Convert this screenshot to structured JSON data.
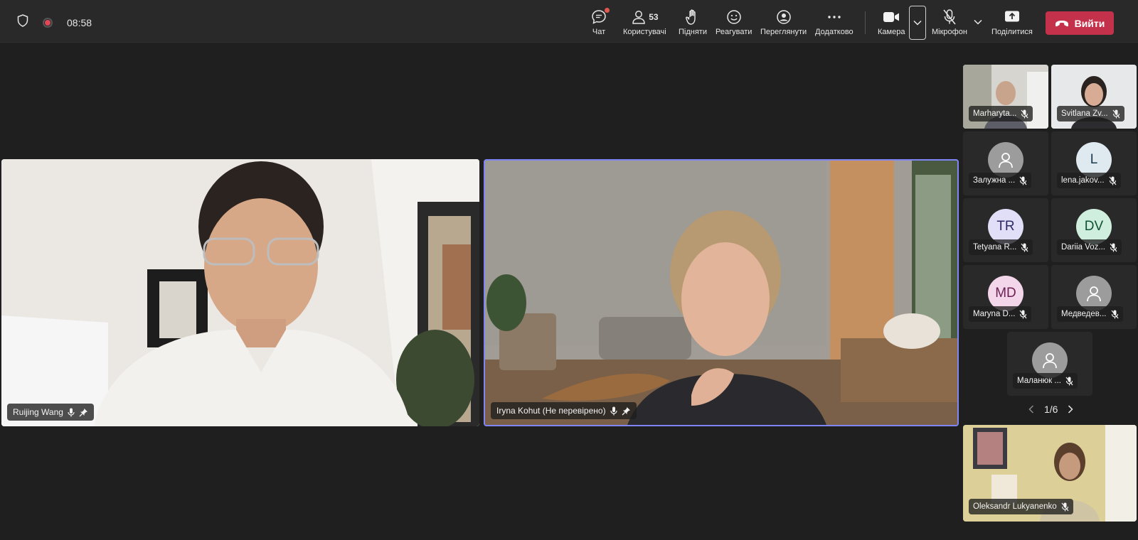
{
  "meeting": {
    "time": "08:58",
    "participant_count": "53"
  },
  "toolbar": {
    "chat": "Чат",
    "people": "Користувачі",
    "raise": "Підняти",
    "react": "Реагувати",
    "view": "Переглянути",
    "more": "Додатково",
    "camera": "Камера",
    "mic": "Мікрофон",
    "share": "Поділитися",
    "leave": "Вийти"
  },
  "main_tiles": [
    {
      "name": "Ruijing Wang"
    },
    {
      "name": "Iryna Kohut (Не перевірено)"
    }
  ],
  "side_tiles": [
    {
      "name": "Marharyta..."
    },
    {
      "name": "Svitlana Zv..."
    },
    {
      "name": "Залужна ...",
      "initials": ""
    },
    {
      "name": "lena.jakov...",
      "initials": "L"
    },
    {
      "name": "Tetyana R...",
      "initials": "TR"
    },
    {
      "name": "Dariia Voz...",
      "initials": "DV"
    },
    {
      "name": "Maryna D...",
      "initials": "MD"
    },
    {
      "name": "Медведев...",
      "initials": ""
    },
    {
      "name": "Маланюк ...",
      "initials": ""
    }
  ],
  "pager": {
    "label": "1/6"
  },
  "self_tile": {
    "name": "Oleksandr Lukyanenko"
  },
  "colors": {
    "leave": "#c4314b",
    "active_border": "#7f85f5",
    "tr_bg": "#e1dff8",
    "dv_bg": "#cfeedd",
    "md_bg": "#f3d6ea"
  }
}
